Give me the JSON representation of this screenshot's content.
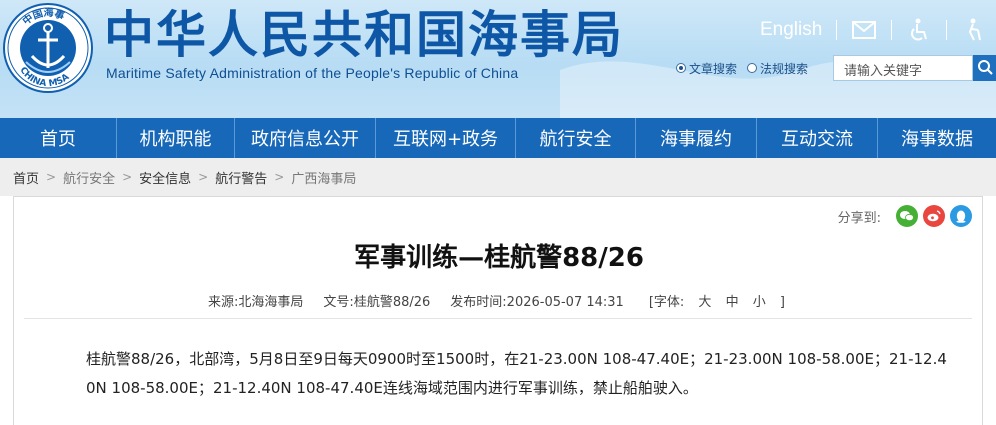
{
  "site": {
    "title_cn": "中华人民共和国海事局",
    "title_en": "Maritime Safety Administration of the People's Republic of China",
    "logo_text": "CHINA MSA",
    "logo_text_cn": "中国海事"
  },
  "top_links": {
    "english": "English",
    "icons": [
      "mail-icon",
      "accessibility-icon",
      "elderly-mode-icon"
    ]
  },
  "search": {
    "option_articles": "文章搜索",
    "option_regulations": "法规搜索",
    "selected": "文章搜索",
    "placeholder": "请输入关键字"
  },
  "nav": {
    "items": [
      "首页",
      "机构职能",
      "政府信息公开",
      "互联网+政务",
      "航行安全",
      "海事履约",
      "互动交流",
      "海事数据"
    ]
  },
  "breadcrumb": [
    "首页",
    "航行安全",
    "安全信息",
    "航行警告",
    "广西海事局"
  ],
  "share": {
    "label": "分享到:",
    "icons": [
      "wechat-icon",
      "weibo-icon",
      "qq-icon"
    ],
    "colors": [
      "#45b035",
      "#e8463f",
      "#2a9ae2"
    ]
  },
  "article": {
    "title": "军事训练—桂航警88/26",
    "source_label": "来源:",
    "source": "北海海事局",
    "doc_label": "文号:",
    "doc_no": "桂航警88/26",
    "date_label": "发布时间:",
    "date": "2026-05-07 14:31",
    "font_label": "[字体:",
    "font_large": "大",
    "font_medium": "中",
    "font_small": "小",
    "font_close": "]",
    "body": "桂航警88/26，北部湾，5月8日至9日每天0900时至1500时，在21-23.00N 108-47.40E；21-23.00N 108-58.00E；21-12.40N 108-58.00E；21-12.40N 108-47.40E连线海域范围内进行军事训练，禁止船舶驶入。"
  },
  "colors": {
    "brand_blue": "#1768b8",
    "title_blue": "#0e57a6",
    "header_bg": "#c4e2f6"
  }
}
